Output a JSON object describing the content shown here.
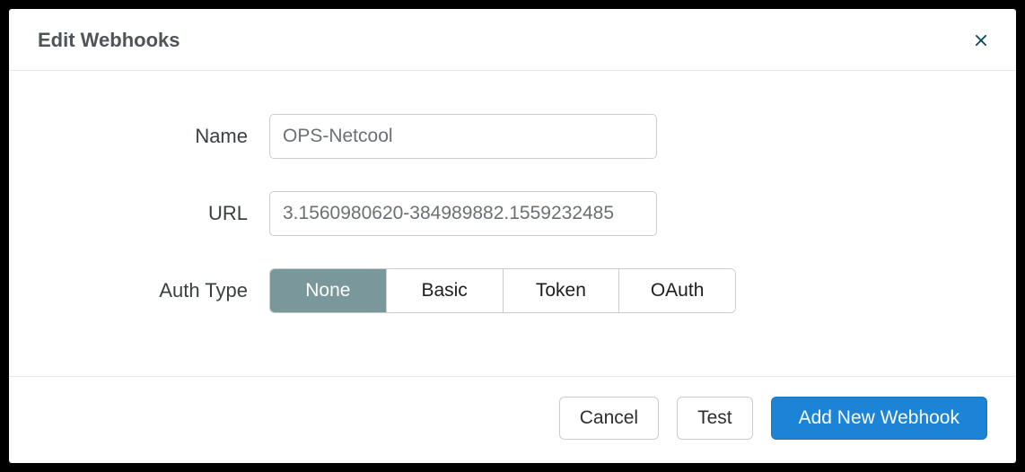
{
  "dialog": {
    "title": "Edit Webhooks"
  },
  "form": {
    "name": {
      "label": "Name",
      "value": "OPS-Netcool"
    },
    "url": {
      "label": "URL",
      "value": "3.1560980620-384989882.1559232485"
    },
    "authType": {
      "label": "Auth Type",
      "options": [
        "None",
        "Basic",
        "Token",
        "OAuth"
      ],
      "selected": "None"
    }
  },
  "footer": {
    "cancel": "Cancel",
    "test": "Test",
    "submit": "Add New Webhook"
  }
}
